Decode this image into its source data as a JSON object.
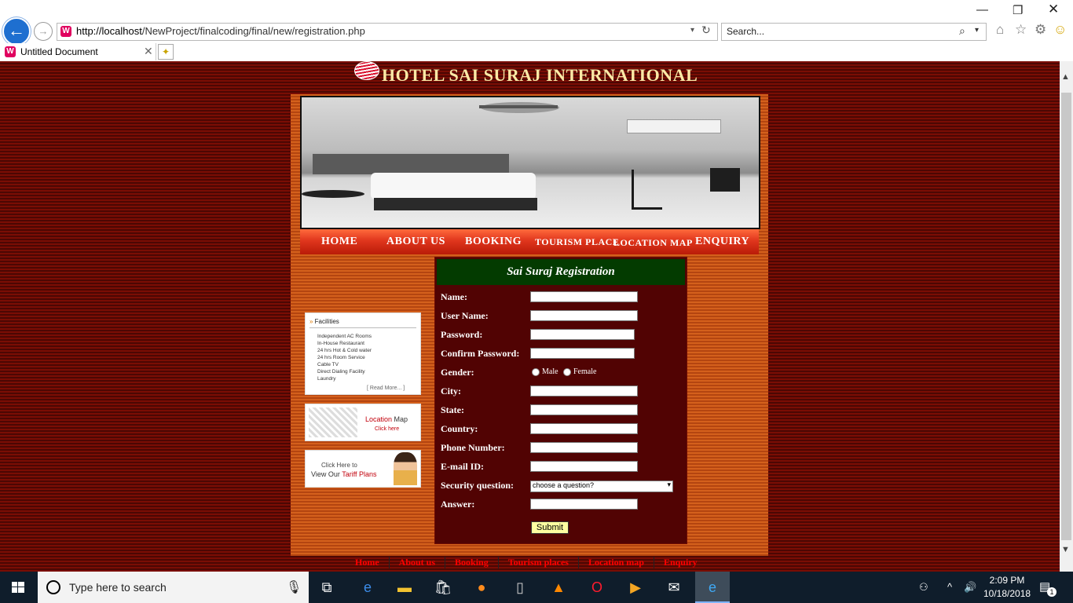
{
  "browser": {
    "url_host": "http://localhost",
    "url_path": "/NewProject/finalcoding/final/new/registration.php",
    "search_placeholder": "Search...",
    "tab_title": "Untitled Document",
    "site_icon_letter": "W"
  },
  "page": {
    "hotel_name": "HOTEL SAI SURAJ INTERNATIONAL",
    "nav": [
      "HOME",
      "ABOUT US",
      "BOOKING",
      "TOURISM PLACE",
      "LOCATION MAP",
      "ENQUIRY"
    ],
    "facilities": {
      "title": "Facilities",
      "items": [
        "Independent AC Rooms",
        "In-House Restaurant",
        "24 hrs Hot & Cold water",
        "24 hrs Room Service",
        "Cable TV",
        "Direct Dialing Facility",
        "Laundry"
      ],
      "read_more": "[ Read More... ]"
    },
    "location_card": {
      "word1": "Location",
      "word2": "Map",
      "click": "Click here"
    },
    "tariff_card": {
      "line1": "Click Here to",
      "prefix": "View Our ",
      "highlight": "Tariff Plans"
    },
    "form": {
      "title": "Sai Suraj Registration",
      "labels": {
        "name": "Name:",
        "username": "User Name:",
        "password": "Password:",
        "confirm_password": "Confirm Password:",
        "gender": "Gender:",
        "city": "City:",
        "state": "State:",
        "country": "Country:",
        "phone": "Phone Number:",
        "email": "E-mail ID:",
        "security_question": "Security question:",
        "answer": "Answer:"
      },
      "gender_options": [
        "Male",
        "Female"
      ],
      "security_selected": "choose a question?",
      "submit_label": "Submit"
    },
    "footer_links": [
      "Home",
      "About us",
      "Booking",
      "Tourism places",
      "Location map",
      "Enquiry"
    ]
  },
  "taskbar": {
    "search_placeholder": "Type here to search",
    "time": "2:09 PM",
    "date": "10/18/2018",
    "notification_count": "1"
  },
  "colors": {
    "page_bg": "#7a0d04",
    "container_bg": "#d4601c",
    "form_bg": "#510303",
    "form_header_bg": "#033b00",
    "title_text": "#fbe9a6",
    "footer_link": "#ff0000"
  }
}
